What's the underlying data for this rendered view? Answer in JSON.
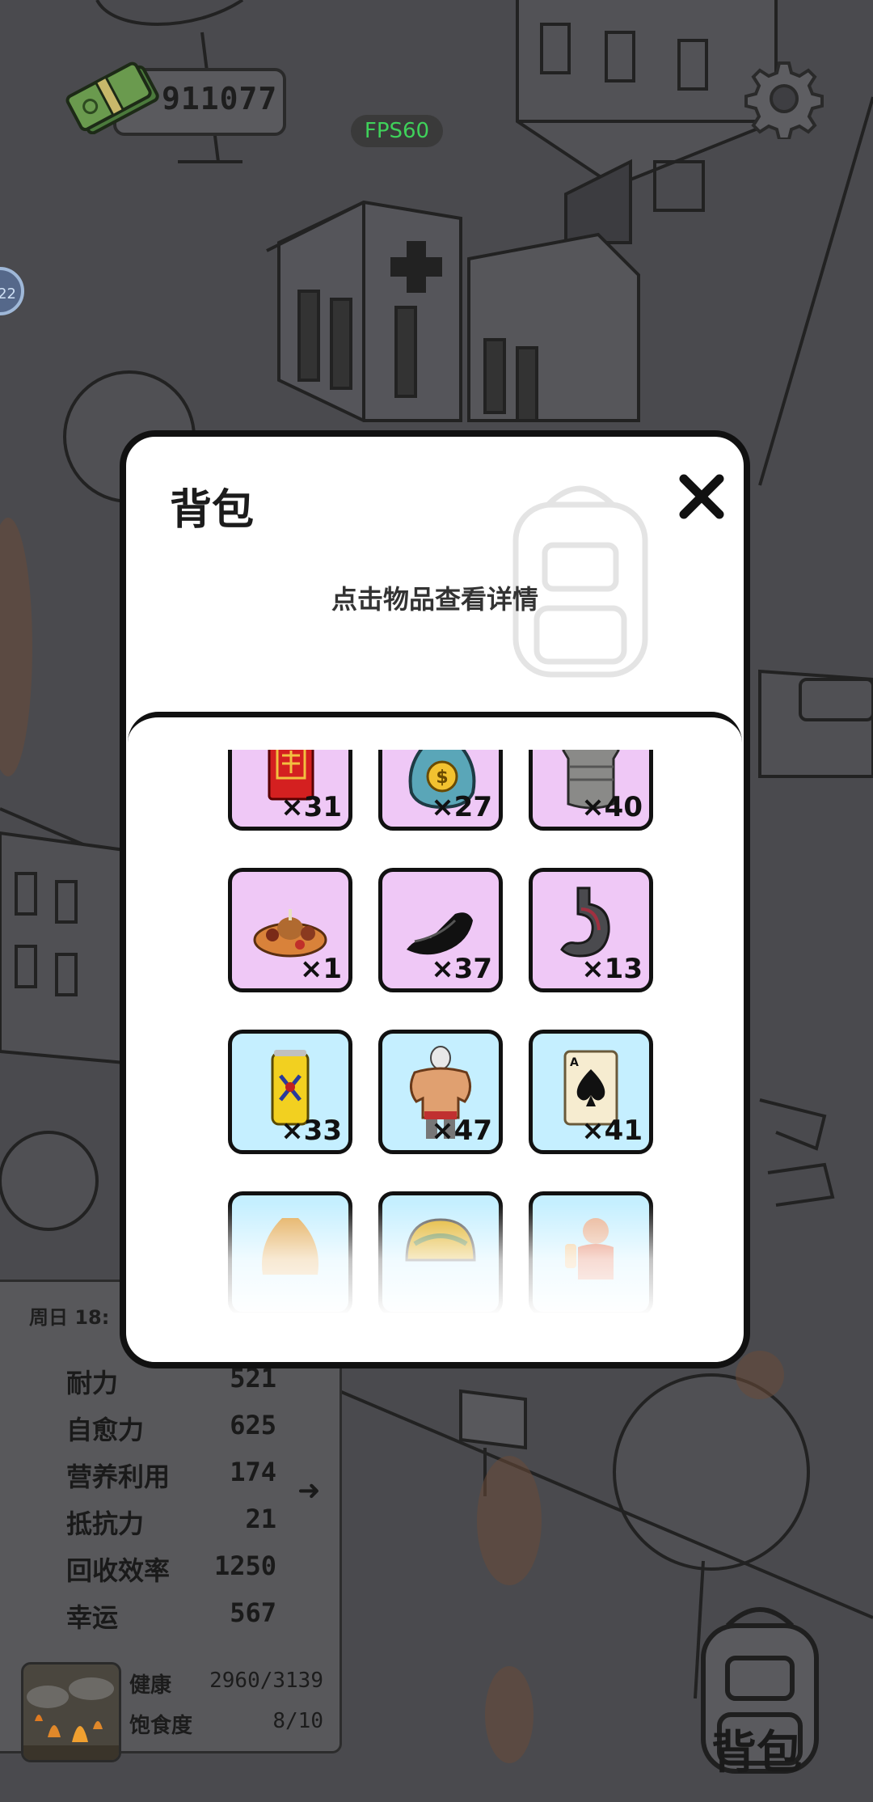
{
  "hud": {
    "money": "911077",
    "fps": "FPS60",
    "side_badge": "22"
  },
  "stats": {
    "time": "周日 18:",
    "rows": [
      {
        "label": "耐力",
        "value": "521"
      },
      {
        "label": "自愈力",
        "value": "625"
      },
      {
        "label": "营养利用",
        "value": "174"
      },
      {
        "label": "抵抗力",
        "value": "21"
      },
      {
        "label": "回收效率",
        "value": "1250"
      },
      {
        "label": "幸运",
        "value": "567"
      }
    ],
    "health_label": "健康",
    "health_value": "2960/3139",
    "satiety_label": "饱食度",
    "satiety_value": "8/10"
  },
  "bag_button": {
    "label": "背包"
  },
  "modal": {
    "title": "背包",
    "hint": "点击物品查看详情",
    "items": [
      {
        "icon": "red-envelope-icon",
        "count": "×31",
        "color": "purple"
      },
      {
        "icon": "money-bag-icon",
        "count": "×27",
        "color": "purple"
      },
      {
        "icon": "body-armor-icon",
        "count": "×40",
        "color": "purple"
      },
      {
        "icon": "feast-platter-icon",
        "count": "×1",
        "color": "purple"
      },
      {
        "icon": "shoes-icon",
        "count": "×37",
        "color": "purple"
      },
      {
        "icon": "stomach-icon",
        "count": "×13",
        "color": "purple"
      },
      {
        "icon": "energy-drink-icon",
        "count": "×33",
        "color": "blue"
      },
      {
        "icon": "muscle-man-icon",
        "count": "×47",
        "color": "blue"
      },
      {
        "icon": "spade-card-icon",
        "count": "×41",
        "color": "blue"
      },
      {
        "icon": "sack-icon",
        "count": "",
        "color": "blue"
      },
      {
        "icon": "helmet-icon",
        "count": "",
        "color": "blue"
      },
      {
        "icon": "figure-icon",
        "count": "",
        "color": "blue"
      }
    ]
  },
  "colors": {
    "purple_item": "#efc8f6",
    "blue_item": "#c5efff",
    "fps_text": "#3fd15a"
  }
}
